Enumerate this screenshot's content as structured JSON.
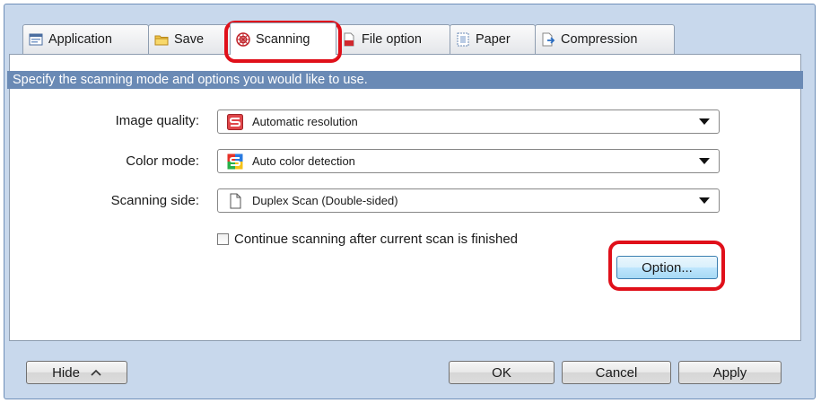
{
  "tabs": [
    {
      "label": "Application",
      "icon": "application-icon"
    },
    {
      "label": "Save",
      "icon": "save-folder-icon"
    },
    {
      "label": "Scanning",
      "icon": "scanning-icon",
      "active": true
    },
    {
      "label": "File option",
      "icon": "file-option-icon"
    },
    {
      "label": "Paper",
      "icon": "paper-icon"
    },
    {
      "label": "Compression",
      "icon": "compression-icon"
    }
  ],
  "banner": "Specify the scanning mode and options you would like to use.",
  "settings": {
    "image_quality": {
      "label": "Image quality:",
      "value": "Automatic resolution",
      "icon": "scansnap-red-icon"
    },
    "color_mode": {
      "label": "Color mode:",
      "value": "Auto color detection",
      "icon": "scansnap-color-icon"
    },
    "scanning_side": {
      "label": "Scanning side:",
      "value": "Duplex Scan (Double-sided)",
      "icon": "page-icon"
    }
  },
  "continue_scanning": {
    "label": "Continue scanning after current scan is finished",
    "checked": false
  },
  "buttons": {
    "option": "Option...",
    "hide": "Hide",
    "ok": "OK",
    "cancel": "Cancel",
    "apply": "Apply"
  },
  "colors": {
    "window_bg": "#c8d8ec",
    "banner_bg": "#6a8ab5",
    "highlight": "#e0101a"
  }
}
